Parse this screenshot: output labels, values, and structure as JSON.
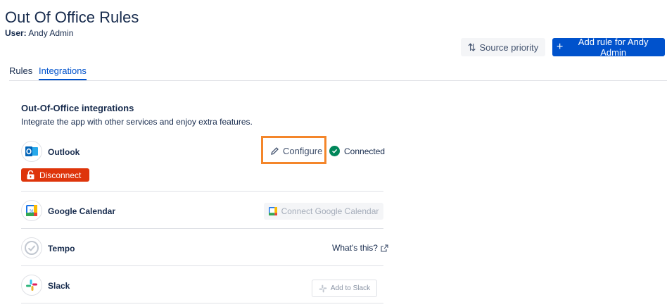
{
  "page": {
    "title": "Out Of Office Rules",
    "user_label": "User:",
    "user_name": "Andy Admin"
  },
  "toolbar": {
    "source_priority_label": "Source priority",
    "add_rule_label": "Add rule for Andy Admin"
  },
  "tabs": [
    {
      "label": "Rules",
      "active": false
    },
    {
      "label": "Integrations",
      "active": true
    }
  ],
  "integrations": {
    "title": "Out-Of-Office integrations",
    "description": "Integrate the app with other services and enjoy extra features.",
    "items": [
      {
        "name": "Outlook",
        "icon": "outlook-icon",
        "action_label": "Configure",
        "status": "Connected",
        "disconnect_label": "Disconnect"
      },
      {
        "name": "Google Calendar",
        "icon": "google-calendar-icon",
        "action_label": "Connect Google Calendar"
      },
      {
        "name": "Tempo",
        "icon": "tempo-icon",
        "action_label": "What's this?"
      },
      {
        "name": "Slack",
        "icon": "slack-icon",
        "action_label": "Add to Slack"
      }
    ]
  },
  "colors": {
    "primary": "#0052cc",
    "danger": "#de350b",
    "success": "#00875a",
    "highlight": "#f4862a"
  }
}
